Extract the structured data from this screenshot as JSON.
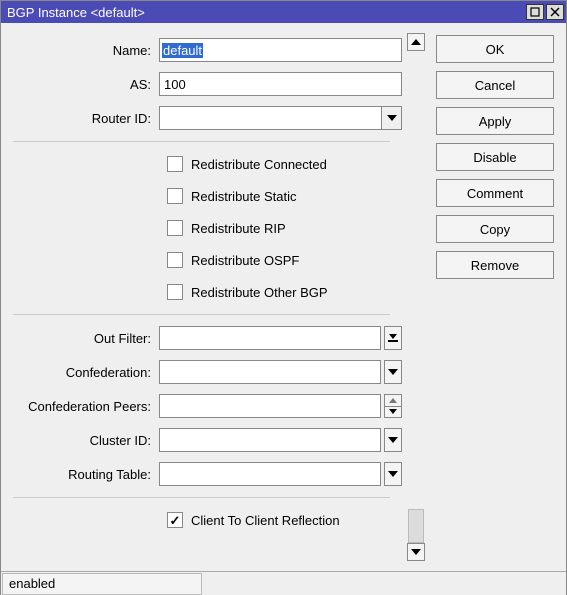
{
  "window": {
    "title": "BGP Instance <default>"
  },
  "form": {
    "name": {
      "label": "Name:",
      "value": "default"
    },
    "as": {
      "label": "AS:",
      "value": "100"
    },
    "router_id": {
      "label": "Router ID:",
      "value": ""
    },
    "redistribute_connected": {
      "label": "Redistribute Connected",
      "checked": false
    },
    "redistribute_static": {
      "label": "Redistribute Static",
      "checked": false
    },
    "redistribute_rip": {
      "label": "Redistribute RIP",
      "checked": false
    },
    "redistribute_ospf": {
      "label": "Redistribute OSPF",
      "checked": false
    },
    "redistribute_other_bgp": {
      "label": "Redistribute Other BGP",
      "checked": false
    },
    "out_filter": {
      "label": "Out Filter:",
      "value": ""
    },
    "confederation": {
      "label": "Confederation:",
      "value": ""
    },
    "confederation_peers": {
      "label": "Confederation Peers:",
      "value": ""
    },
    "cluster_id": {
      "label": "Cluster ID:",
      "value": ""
    },
    "routing_table": {
      "label": "Routing Table:",
      "value": ""
    },
    "client_to_client_reflection": {
      "label": "Client To Client Reflection",
      "checked": true
    }
  },
  "buttons": {
    "ok": "OK",
    "cancel": "Cancel",
    "apply": "Apply",
    "disable": "Disable",
    "comment": "Comment",
    "copy": "Copy",
    "remove": "Remove"
  },
  "status": "enabled"
}
